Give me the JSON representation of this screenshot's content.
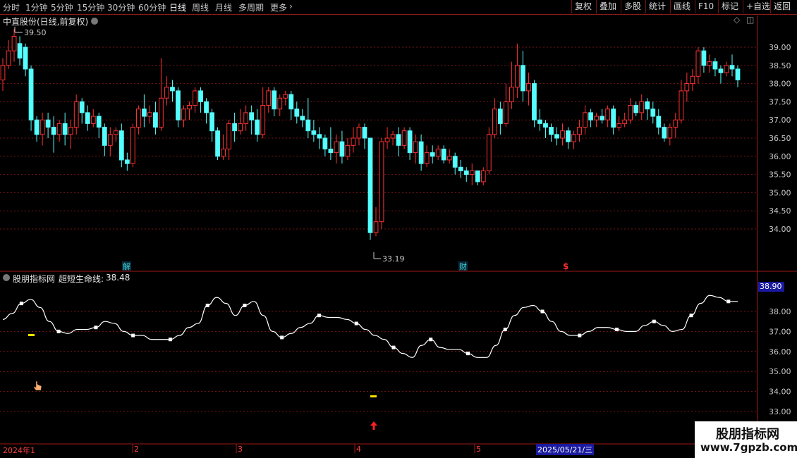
{
  "toolbar": {
    "periods": [
      "分时",
      "1分钟",
      "5分钟",
      "15分钟",
      "30分钟",
      "60分钟",
      "日线",
      "周线",
      "月线",
      "多周期",
      "更多"
    ],
    "active_period": "日线",
    "right_buttons": [
      "复权",
      "叠加",
      "多股",
      "统计",
      "画线",
      "F10",
      "标记",
      "+自选",
      "返回"
    ]
  },
  "main_chart": {
    "title": "中直股份(日线,前复权)",
    "high_label": "39.50",
    "low_label": "33.19",
    "event_markers": [
      {
        "text": "解",
        "color": "#3ad0d8"
      },
      {
        "text": "财",
        "color": "#3ad0d8"
      },
      {
        "text": "$",
        "color": "#ff3333"
      }
    ]
  },
  "indicator": {
    "title": "股朋指标网",
    "line_name": "超短生命线:",
    "line_value": "38.48",
    "last_value_box": "38.90"
  },
  "time_axis": {
    "labels": [
      "2024年1",
      "2",
      "3",
      "4",
      "5"
    ],
    "cursor_date": "2025/05/21/三"
  },
  "watermark": {
    "title": "股朋指标网",
    "url": "www.7gpzb.com"
  },
  "chart_data": [
    {
      "type": "candlestick",
      "title": "中直股份(日线,前复权)",
      "y_ticks": [
        34.0,
        34.5,
        35.0,
        35.5,
        36.0,
        36.5,
        37.0,
        37.5,
        38.0,
        38.5,
        39.0
      ],
      "ylim": [
        33.4,
        39.5
      ],
      "grid": true,
      "up_color": "#ff3232",
      "down_color": "#54ffff",
      "candles": [
        [
          38.1,
          38.5,
          37.8,
          38.7
        ],
        [
          38.5,
          38.9,
          38.4,
          39.2
        ],
        [
          38.9,
          39.3,
          38.6,
          39.5
        ],
        [
          39.1,
          38.7,
          38.5,
          39.3
        ],
        [
          39.0,
          38.4,
          38.2,
          39.1
        ],
        [
          38.4,
          37.0,
          36.7,
          38.5
        ],
        [
          37.0,
          36.6,
          36.4,
          37.1
        ],
        [
          36.6,
          37.0,
          36.3,
          37.2
        ],
        [
          37.0,
          36.8,
          36.5,
          37.2
        ],
        [
          36.8,
          36.6,
          36.1,
          37.1
        ],
        [
          36.6,
          36.9,
          36.4,
          37.0
        ],
        [
          36.9,
          36.6,
          36.3,
          37.2
        ],
        [
          36.6,
          36.8,
          36.2,
          37.0
        ],
        [
          36.8,
          37.5,
          36.6,
          37.7
        ],
        [
          37.5,
          37.2,
          36.9,
          37.6
        ],
        [
          37.2,
          36.9,
          36.7,
          37.4
        ],
        [
          36.9,
          37.1,
          36.8,
          37.3
        ],
        [
          37.1,
          36.8,
          36.5,
          37.2
        ],
        [
          36.8,
          36.3,
          36.0,
          36.9
        ],
        [
          36.3,
          36.6,
          36.0,
          36.8
        ],
        [
          36.6,
          36.7,
          36.4,
          36.8
        ],
        [
          36.7,
          35.9,
          35.7,
          36.9
        ],
        [
          35.9,
          35.8,
          35.6,
          36.1
        ],
        [
          35.8,
          36.8,
          35.7,
          36.9
        ],
        [
          36.8,
          37.3,
          36.6,
          37.4
        ],
        [
          37.3,
          37.1,
          36.8,
          37.7
        ],
        [
          37.1,
          37.2,
          36.9,
          37.4
        ],
        [
          37.2,
          36.8,
          36.6,
          37.5
        ],
        [
          36.8,
          37.6,
          36.7,
          38.7
        ],
        [
          37.6,
          37.9,
          37.4,
          38.2
        ],
        [
          37.9,
          37.8,
          37.5,
          38.1
        ],
        [
          37.8,
          37.0,
          36.8,
          37.9
        ],
        [
          37.0,
          37.3,
          36.8,
          37.4
        ],
        [
          37.3,
          37.4,
          37.0,
          37.5
        ],
        [
          37.4,
          37.8,
          37.2,
          37.9
        ],
        [
          37.8,
          37.5,
          37.2,
          37.9
        ],
        [
          37.5,
          37.2,
          36.9,
          37.6
        ],
        [
          37.2,
          36.7,
          36.4,
          37.3
        ],
        [
          36.7,
          36.0,
          35.9,
          36.8
        ],
        [
          36.0,
          36.2,
          35.9,
          36.6
        ],
        [
          36.2,
          36.9,
          35.9,
          37.0
        ],
        [
          36.9,
          36.7,
          36.4,
          37.2
        ],
        [
          36.7,
          36.9,
          36.6,
          37.3
        ],
        [
          36.9,
          37.2,
          36.7,
          37.4
        ],
        [
          37.2,
          37.0,
          36.6,
          37.4
        ],
        [
          37.0,
          36.6,
          36.4,
          37.3
        ],
        [
          36.6,
          37.4,
          36.5,
          37.9
        ],
        [
          37.4,
          37.8,
          37.2,
          37.9
        ],
        [
          37.8,
          37.3,
          37.1,
          37.9
        ],
        [
          37.3,
          37.6,
          37.1,
          37.7
        ],
        [
          37.6,
          37.7,
          37.4,
          37.8
        ],
        [
          37.7,
          37.3,
          37.0,
          37.8
        ],
        [
          37.3,
          37.1,
          36.9,
          37.5
        ],
        [
          37.1,
          37.0,
          36.8,
          37.3
        ],
        [
          37.0,
          36.7,
          36.5,
          37.6
        ],
        [
          36.7,
          36.6,
          36.4,
          37.0
        ],
        [
          36.6,
          36.5,
          36.2,
          36.8
        ],
        [
          36.5,
          36.2,
          36.0,
          36.6
        ],
        [
          36.2,
          36.1,
          35.9,
          36.8
        ],
        [
          36.1,
          36.4,
          35.8,
          36.6
        ],
        [
          36.4,
          36.0,
          35.8,
          36.7
        ],
        [
          36.0,
          36.3,
          35.9,
          36.5
        ],
        [
          36.3,
          36.5,
          36.1,
          36.8
        ],
        [
          36.5,
          36.8,
          36.3,
          36.9
        ],
        [
          36.8,
          36.5,
          36.2,
          36.9
        ],
        [
          36.5,
          33.9,
          33.7,
          35.6
        ],
        [
          33.9,
          34.2,
          33.8,
          34.6
        ],
        [
          34.2,
          36.4,
          34.0,
          36.5
        ],
        [
          36.4,
          36.5,
          36.2,
          36.8
        ],
        [
          36.5,
          36.6,
          36.3,
          36.7
        ],
        [
          36.6,
          36.3,
          36.0,
          36.8
        ],
        [
          36.3,
          36.7,
          36.2,
          36.8
        ],
        [
          36.7,
          36.1,
          35.9,
          36.8
        ],
        [
          36.1,
          36.4,
          35.8,
          36.6
        ],
        [
          36.4,
          35.8,
          35.6,
          36.6
        ],
        [
          35.8,
          36.1,
          35.7,
          36.3
        ],
        [
          36.1,
          36.0,
          35.8,
          36.3
        ],
        [
          36.0,
          36.2,
          35.9,
          36.3
        ],
        [
          36.2,
          35.9,
          35.8,
          36.3
        ],
        [
          35.9,
          36.0,
          35.8,
          36.2
        ],
        [
          36.0,
          35.7,
          35.5,
          36.1
        ],
        [
          35.7,
          35.6,
          35.4,
          35.9
        ],
        [
          35.6,
          35.5,
          35.3,
          35.7
        ],
        [
          35.5,
          35.6,
          35.2,
          35.8
        ],
        [
          35.6,
          35.3,
          35.2,
          35.5
        ],
        [
          35.3,
          35.6,
          35.2,
          35.7
        ],
        [
          35.6,
          36.6,
          35.5,
          36.8
        ],
        [
          36.6,
          37.3,
          36.5,
          37.6
        ],
        [
          37.3,
          36.9,
          36.6,
          37.5
        ],
        [
          36.9,
          37.5,
          36.8,
          38.0
        ],
        [
          37.5,
          37.9,
          37.3,
          38.6
        ],
        [
          37.9,
          38.5,
          37.6,
          39.1
        ],
        [
          38.5,
          37.8,
          37.5,
          38.9
        ],
        [
          37.8,
          38.0,
          37.4,
          38.3
        ],
        [
          38.0,
          37.0,
          36.8,
          38.1
        ],
        [
          37.0,
          36.9,
          36.7,
          37.3
        ],
        [
          36.9,
          36.8,
          36.5,
          37.0
        ],
        [
          36.8,
          36.6,
          36.4,
          36.9
        ],
        [
          36.6,
          36.5,
          36.3,
          36.8
        ],
        [
          36.5,
          36.7,
          36.3,
          36.9
        ],
        [
          36.7,
          36.4,
          36.2,
          36.8
        ],
        [
          36.4,
          36.6,
          36.2,
          36.7
        ],
        [
          36.6,
          36.8,
          36.4,
          37.0
        ],
        [
          36.8,
          37.2,
          36.6,
          37.4
        ],
        [
          37.2,
          37.0,
          36.8,
          37.3
        ],
        [
          37.0,
          37.1,
          36.8,
          37.2
        ],
        [
          37.1,
          37.0,
          36.9,
          37.3
        ],
        [
          37.0,
          37.3,
          36.8,
          37.4
        ],
        [
          37.3,
          36.8,
          36.6,
          37.4
        ],
        [
          36.8,
          36.9,
          36.7,
          37.1
        ],
        [
          36.9,
          37.0,
          36.8,
          37.2
        ],
        [
          37.0,
          37.4,
          36.9,
          37.6
        ],
        [
          37.4,
          37.2,
          37.1,
          37.5
        ],
        [
          37.2,
          37.5,
          37.0,
          37.7
        ],
        [
          37.5,
          37.3,
          37.0,
          37.6
        ],
        [
          37.3,
          37.1,
          36.9,
          37.5
        ],
        [
          37.1,
          36.8,
          36.6,
          37.3
        ],
        [
          36.8,
          36.5,
          36.4,
          36.9
        ],
        [
          36.5,
          36.8,
          36.3,
          36.9
        ],
        [
          36.8,
          37.0,
          36.5,
          37.2
        ],
        [
          37.0,
          37.8,
          36.9,
          38.1
        ],
        [
          37.8,
          38.0,
          37.5,
          38.3
        ],
        [
          38.0,
          38.2,
          37.8,
          38.4
        ],
        [
          38.2,
          38.9,
          38.0,
          39.0
        ],
        [
          38.9,
          38.5,
          38.3,
          39.0
        ],
        [
          38.5,
          38.6,
          38.3,
          38.8
        ],
        [
          38.6,
          38.4,
          38.2,
          38.7
        ],
        [
          38.4,
          38.3,
          38.0,
          38.5
        ],
        [
          38.3,
          38.5,
          38.2,
          38.6
        ],
        [
          38.5,
          38.4,
          38.2,
          38.8
        ],
        [
          38.4,
          38.1,
          37.9,
          38.5
        ]
      ]
    },
    {
      "type": "line",
      "title": "股朋指标网",
      "series": [
        {
          "name": "超短生命线",
          "values": [
            37.6,
            37.9,
            38.4,
            38.6,
            38.2,
            37.5,
            37.0,
            36.9,
            37.1,
            37.1,
            37.2,
            37.5,
            37.4,
            37.0,
            36.8,
            36.8,
            36.6,
            36.6,
            36.6,
            36.8,
            37.2,
            37.4,
            38.3,
            38.7,
            38.4,
            37.8,
            38.3,
            38.5,
            37.8,
            37.0,
            36.7,
            36.9,
            37.2,
            37.4,
            37.8,
            37.7,
            37.7,
            37.6,
            37.4,
            37.1,
            36.8,
            36.6,
            36.2,
            35.9,
            35.7,
            36.3,
            36.6,
            36.2,
            36.1,
            36.1,
            35.9,
            35.7,
            35.7,
            36.3,
            37.1,
            37.8,
            38.2,
            38.3,
            38.0,
            37.5,
            37.0,
            36.8,
            36.8,
            37.0,
            37.2,
            37.2,
            37.1,
            37.0,
            37.0,
            37.3,
            37.5,
            37.3,
            37.0,
            37.1,
            37.8,
            38.4,
            38.8,
            38.7,
            38.5,
            38.5
          ]
        }
      ],
      "y_ticks": [
        33.0,
        34.0,
        35.0,
        36.0,
        37.0,
        38.0
      ],
      "ylim": [
        32.6,
        39.0
      ],
      "grid": true
    }
  ]
}
